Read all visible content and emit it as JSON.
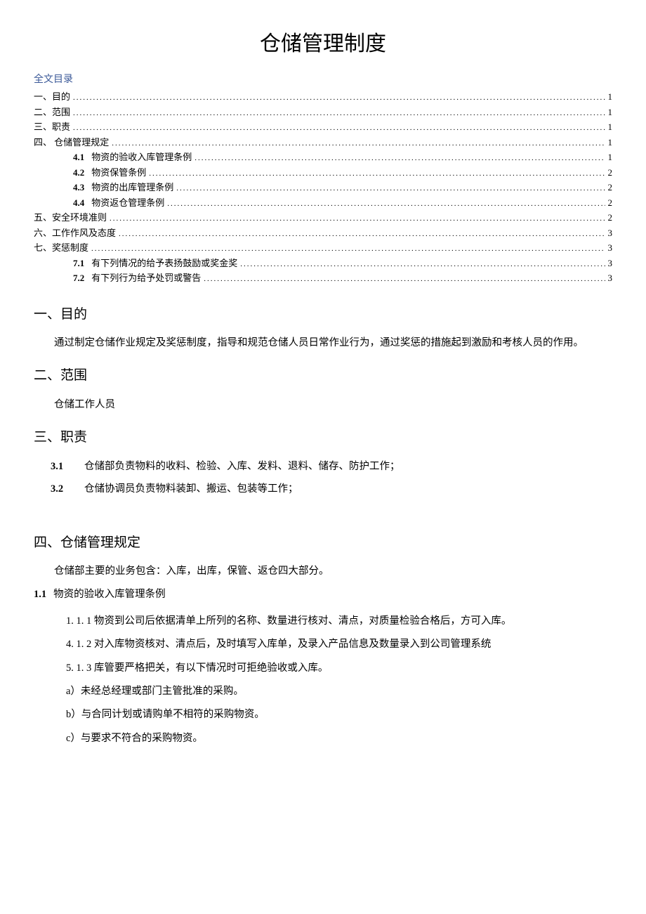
{
  "title": "仓储管理制度",
  "toc": {
    "heading": "全文目录",
    "items": [
      {
        "label": "一、目的",
        "page": "1",
        "sub": false
      },
      {
        "label": "二、范围",
        "page": "1",
        "sub": false
      },
      {
        "label": "三、职责",
        "page": "1",
        "sub": false
      },
      {
        "label": "四、 仓储管理规定",
        "page": "1",
        "sub": false
      },
      {
        "num": "4.1",
        "label": "物资的验收入库管理条例",
        "page": "1",
        "sub": true
      },
      {
        "num": "4.2",
        "label": "物资保管条例",
        "page": "2",
        "sub": true
      },
      {
        "num": "4.3",
        "label": "物资的出库管理条例",
        "page": "2",
        "sub": true
      },
      {
        "num": "4.4",
        "label": "物资返仓管理条例",
        "page": "2",
        "sub": true
      },
      {
        "label": "五、安全环境准则",
        "page": "2",
        "sub": false
      },
      {
        "label": "六、工作作风及态度",
        "page": "3",
        "sub": false
      },
      {
        "label": "七、奖惩制度",
        "page": "3",
        "sub": false
      },
      {
        "num": "7.1",
        "label": "有下列情况的给予表扬鼓励或奖金奖",
        "page": "3",
        "sub": true
      },
      {
        "num": "7.2",
        "label": "有下列行为给予处罚或警告",
        "page": "3",
        "sub": true
      }
    ]
  },
  "sections": {
    "s1": {
      "heading": "一、目的",
      "body": "通过制定仓储作业规定及奖惩制度，指导和规范仓储人员日常作业行为，通过奖惩的措施起到激励和考核人员的作用。"
    },
    "s2": {
      "heading": "二、范围",
      "body": "仓储工作人员"
    },
    "s3": {
      "heading": "三、职责",
      "items": [
        {
          "num": "3.1",
          "text": "仓储部负责物料的收料、检验、入库、发料、退料、储存、防护工作；"
        },
        {
          "num": "3.2",
          "text": "仓储协调员负责物料装卸、搬运、包装等工作；"
        }
      ]
    },
    "s4": {
      "heading": "四、仓储管理规定",
      "intro": "仓储部主要的业务包含：入库，出库，保管、返仓四大部分。",
      "sub1": {
        "num": "1.1",
        "title": "物资的验收入库管理条例"
      },
      "lines": [
        "1.  1. 1 物资到公司后依据清单上所列的名称、数量进行核对、清点，对质量检验合格后，方可入库。",
        "4.  1. 2 对入库物资核对、清点后，及时填写入库单，及录入产品信息及数量录入到公司管理系统",
        "5.      1. 3 库管要严格把关，有以下情况时可拒绝验收或入库。",
        "a）未经总经理或部门主管批准的采购。",
        "b）与合同计划或请购单不相符的采购物资。",
        "c）与要求不符合的采购物资。"
      ]
    }
  }
}
